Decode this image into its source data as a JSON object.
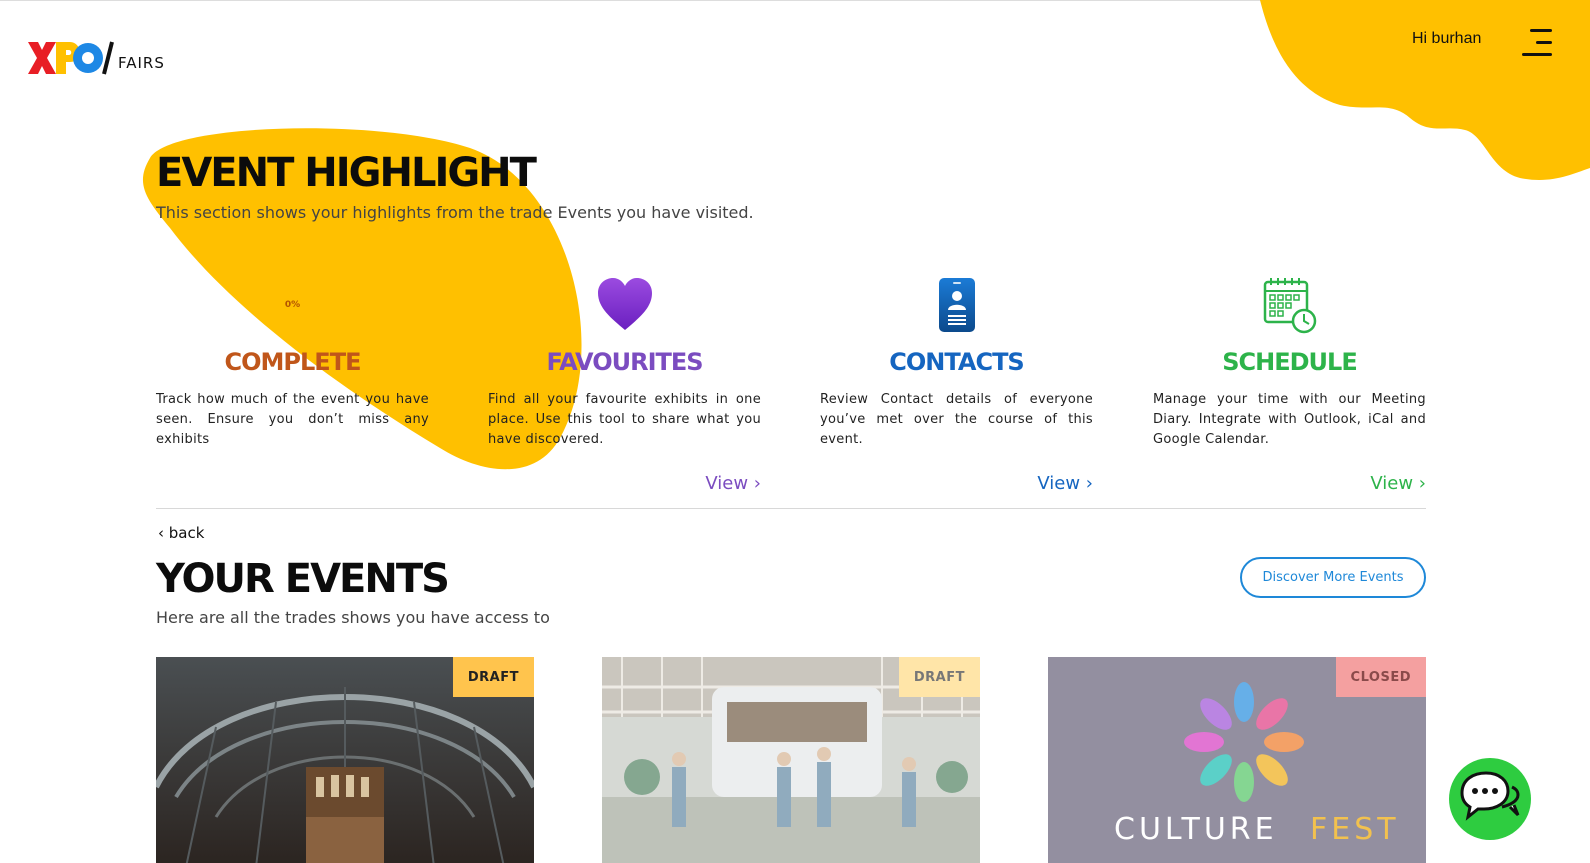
{
  "header": {
    "logo_text": "XPO",
    "logo_suffix": "FAIRS",
    "greeting": "Hi burhan",
    "colors": {
      "accent_yellow": "#FFC000"
    }
  },
  "highlight": {
    "title": "EVENT HIGHLIGHT",
    "subtitle": "This section shows your highlights from the trade Events you have visited.",
    "cards": [
      {
        "title": "COMPLETE",
        "percent_label": "0%",
        "progress": 0,
        "description": "Track how much of the event you have seen. Ensure you don’t miss any exhibits",
        "color": "#C0561A"
      },
      {
        "title": "FAVOURITES",
        "icon": "heart-icon",
        "description": "Find all your favourite exhibits in one place. Use this tool to share what you have discovered.",
        "view_label": "View ›",
        "color": "#7B4CC0"
      },
      {
        "title": "CONTACTS",
        "icon": "contact-card-icon",
        "description": "Review Contact details of everyone you’ve met over the course of this event.",
        "view_label": "View ›",
        "color": "#1565C0"
      },
      {
        "title": "SCHEDULE",
        "icon": "calendar-clock-icon",
        "description": "Manage your time with our Meeting Diary. Integrate with Outlook, iCal and Google Calendar.",
        "view_label": "View ›",
        "color": "#2DB34A"
      }
    ]
  },
  "events": {
    "back_label": "‹ back",
    "title": "YOUR EVENTS",
    "subtitle": "Here are all the trades shows you have access to",
    "discover_label": "Discover More Events",
    "items": [
      {
        "badge": "DRAFT",
        "badge_color": "#FFC44D",
        "image": "architecture-hall-photo"
      },
      {
        "badge": "DRAFT",
        "badge_color": "#FFE5A8",
        "image": "outdoor-food-truck-photo"
      },
      {
        "badge": "CLOSED",
        "badge_color": "#F4A0A0",
        "image": "culturefest-logo",
        "logo_text_a": "CULTURE",
        "logo_text_b": "FEST"
      }
    ]
  },
  "chat": {
    "icon": "chat-bubbles-icon",
    "color": "#2ECC40"
  }
}
